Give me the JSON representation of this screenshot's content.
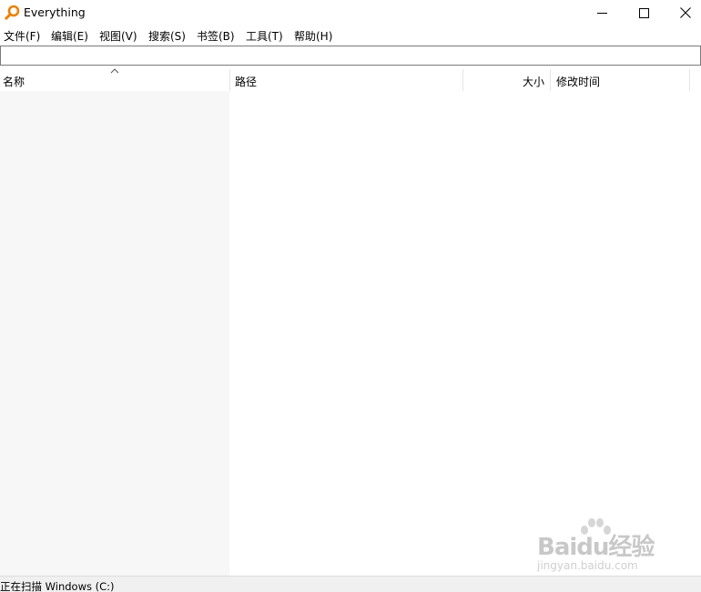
{
  "window": {
    "title": "Everything",
    "icon": "magnifier-app-icon",
    "controls": [
      "minimize-icon",
      "maximize-icon",
      "close-icon"
    ]
  },
  "menu": {
    "items": [
      {
        "label": "文件(F)"
      },
      {
        "label": "编辑(E)"
      },
      {
        "label": "视图(V)"
      },
      {
        "label": "搜索(S)"
      },
      {
        "label": "书签(B)"
      },
      {
        "label": "工具(T)"
      },
      {
        "label": "帮助(H)"
      }
    ]
  },
  "search": {
    "value": "",
    "placeholder": ""
  },
  "columns": {
    "name": "名称",
    "path": "路径",
    "size": "大小",
    "modified": "修改时间",
    "sorted_by": "名称",
    "sort_direction": "ascending"
  },
  "results": [],
  "status": {
    "text": "正在扫描 Windows (C:)"
  },
  "watermark": {
    "brand": "Baidu经验",
    "url": "jingyan.baidu.com"
  },
  "colors": {
    "app_icon": "#e8820c",
    "name_column_bg": "#f7f7f7",
    "statusbar_bg": "#f0f0f0"
  }
}
